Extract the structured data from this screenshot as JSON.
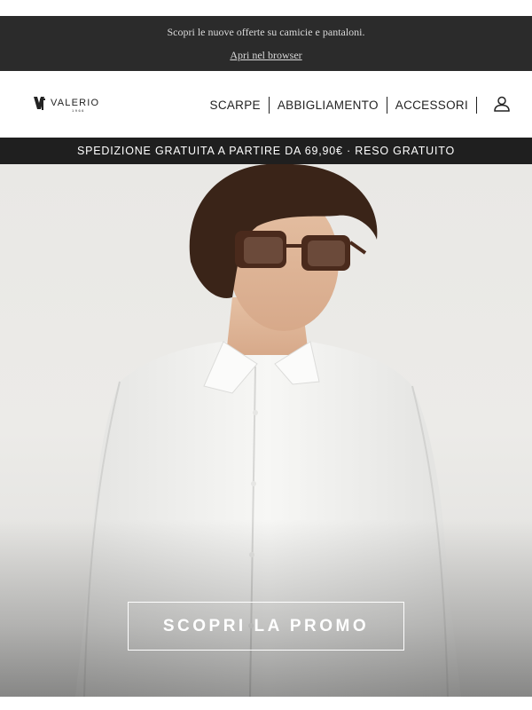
{
  "preheader": {
    "text": "Scopri le nuove offerte su camicie e pantaloni.",
    "browser_link": "Apri nel browser"
  },
  "brand": {
    "name": "VALERIO",
    "year": "1966"
  },
  "nav": {
    "items": [
      "SCARPE",
      "ABBIGLIAMENTO",
      "ACCESSORI"
    ],
    "account_icon": "user-icon"
  },
  "shipping_bar": {
    "text": "SPEDIZIONE GRATUITA A PARTIRE DA 69,90€ · RESO GRATUITO"
  },
  "hero": {
    "cta_label": "SCOPRI LA PROMO"
  },
  "colors": {
    "preheader_bg": "#2b2b2b",
    "shipbar_bg": "#1f1f1f",
    "text": "#222222",
    "cta_border": "#ffffff"
  }
}
